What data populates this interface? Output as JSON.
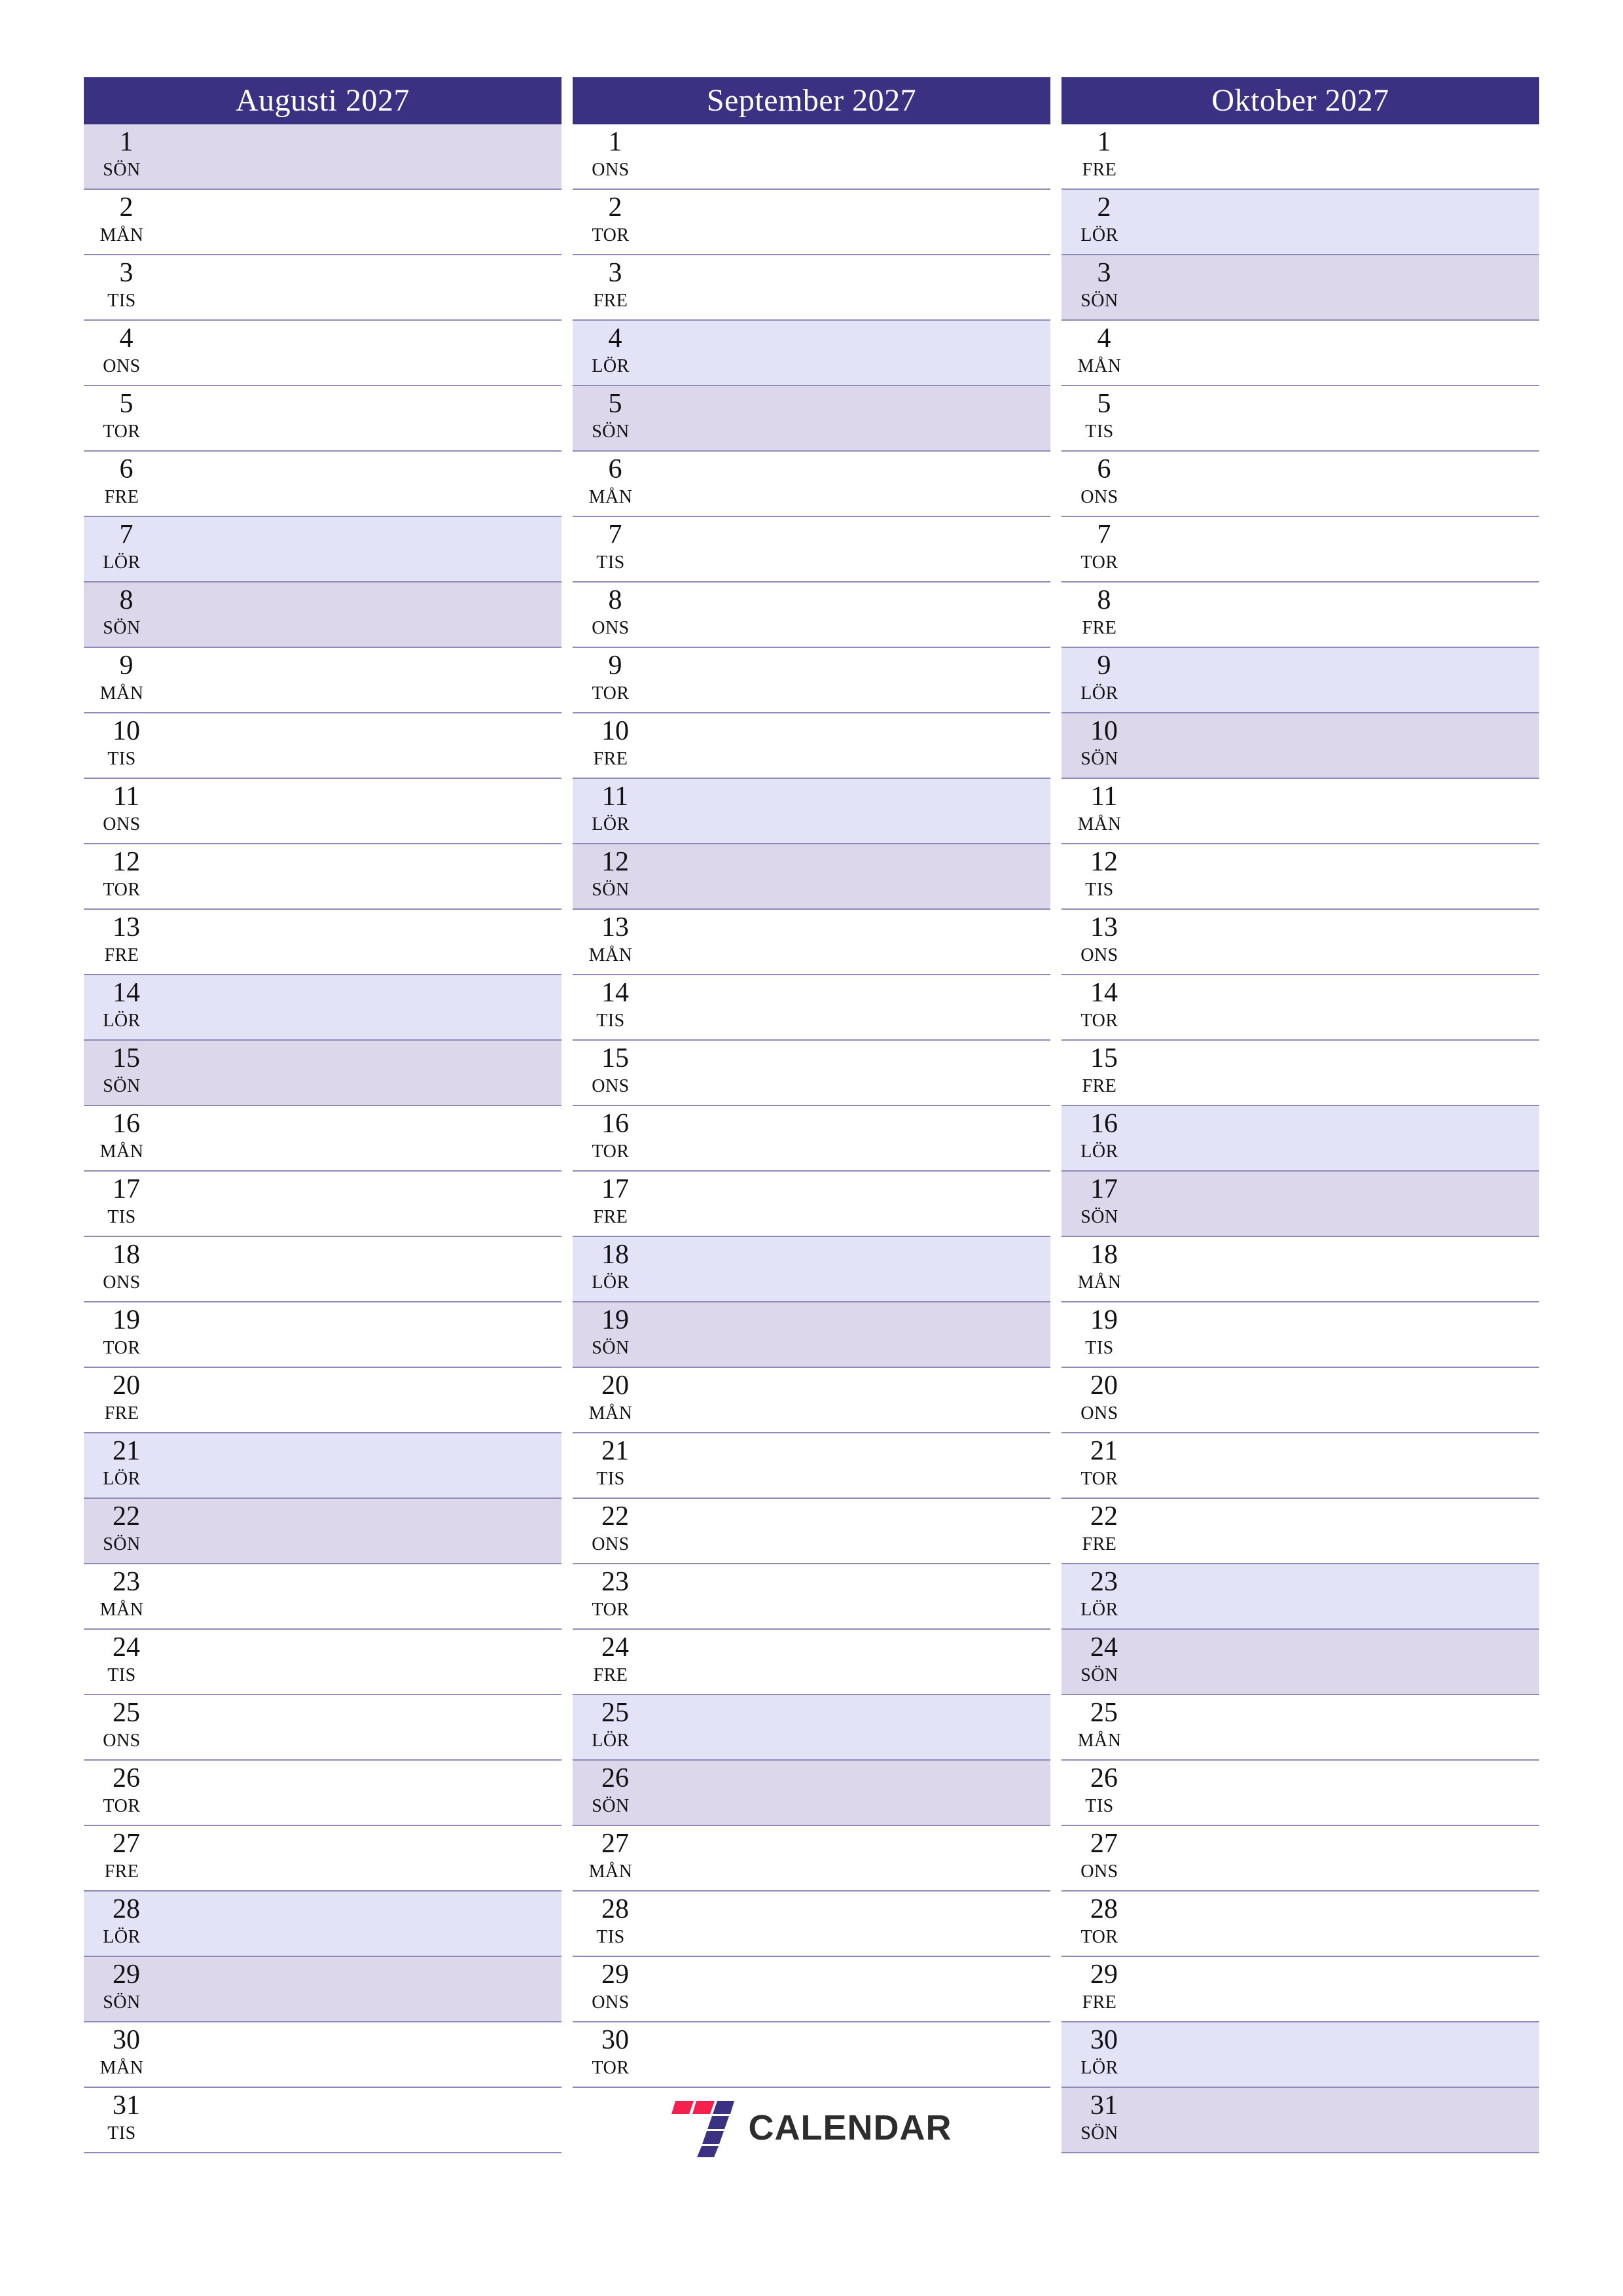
{
  "document": {
    "type": "printable-monthly-planner",
    "language": "sv",
    "year": "2027"
  },
  "colors": {
    "header_bg": "#3b3183",
    "header_text": "#ffffff",
    "saturday_bg": "#e3e3f7",
    "sunday_bg": "#dcd7ea",
    "weekday_bg": "#ffffff",
    "gridline": "#8f8ab9",
    "text": "#111111",
    "logo_red": "#f4204e",
    "logo_blue": "#3b3183",
    "logo_wordmark": "#2d2d2d"
  },
  "brand": {
    "name": "CALENDAR",
    "mark_name": "seven-mark"
  },
  "months": [
    {
      "title": "Augusti 2027",
      "days": [
        {
          "num": "1",
          "wd": "SÖN"
        },
        {
          "num": "2",
          "wd": "MÅN"
        },
        {
          "num": "3",
          "wd": "TIS"
        },
        {
          "num": "4",
          "wd": "ONS"
        },
        {
          "num": "5",
          "wd": "TOR"
        },
        {
          "num": "6",
          "wd": "FRE"
        },
        {
          "num": "7",
          "wd": "LÖR"
        },
        {
          "num": "8",
          "wd": "SÖN"
        },
        {
          "num": "9",
          "wd": "MÅN"
        },
        {
          "num": "10",
          "wd": "TIS"
        },
        {
          "num": "11",
          "wd": "ONS"
        },
        {
          "num": "12",
          "wd": "TOR"
        },
        {
          "num": "13",
          "wd": "FRE"
        },
        {
          "num": "14",
          "wd": "LÖR"
        },
        {
          "num": "15",
          "wd": "SÖN"
        },
        {
          "num": "16",
          "wd": "MÅN"
        },
        {
          "num": "17",
          "wd": "TIS"
        },
        {
          "num": "18",
          "wd": "ONS"
        },
        {
          "num": "19",
          "wd": "TOR"
        },
        {
          "num": "20",
          "wd": "FRE"
        },
        {
          "num": "21",
          "wd": "LÖR"
        },
        {
          "num": "22",
          "wd": "SÖN"
        },
        {
          "num": "23",
          "wd": "MÅN"
        },
        {
          "num": "24",
          "wd": "TIS"
        },
        {
          "num": "25",
          "wd": "ONS"
        },
        {
          "num": "26",
          "wd": "TOR"
        },
        {
          "num": "27",
          "wd": "FRE"
        },
        {
          "num": "28",
          "wd": "LÖR"
        },
        {
          "num": "29",
          "wd": "SÖN"
        },
        {
          "num": "30",
          "wd": "MÅN"
        },
        {
          "num": "31",
          "wd": "TIS"
        }
      ]
    },
    {
      "title": "September 2027",
      "days": [
        {
          "num": "1",
          "wd": "ONS"
        },
        {
          "num": "2",
          "wd": "TOR"
        },
        {
          "num": "3",
          "wd": "FRE"
        },
        {
          "num": "4",
          "wd": "LÖR"
        },
        {
          "num": "5",
          "wd": "SÖN"
        },
        {
          "num": "6",
          "wd": "MÅN"
        },
        {
          "num": "7",
          "wd": "TIS"
        },
        {
          "num": "8",
          "wd": "ONS"
        },
        {
          "num": "9",
          "wd": "TOR"
        },
        {
          "num": "10",
          "wd": "FRE"
        },
        {
          "num": "11",
          "wd": "LÖR"
        },
        {
          "num": "12",
          "wd": "SÖN"
        },
        {
          "num": "13",
          "wd": "MÅN"
        },
        {
          "num": "14",
          "wd": "TIS"
        },
        {
          "num": "15",
          "wd": "ONS"
        },
        {
          "num": "16",
          "wd": "TOR"
        },
        {
          "num": "17",
          "wd": "FRE"
        },
        {
          "num": "18",
          "wd": "LÖR"
        },
        {
          "num": "19",
          "wd": "SÖN"
        },
        {
          "num": "20",
          "wd": "MÅN"
        },
        {
          "num": "21",
          "wd": "TIS"
        },
        {
          "num": "22",
          "wd": "ONS"
        },
        {
          "num": "23",
          "wd": "TOR"
        },
        {
          "num": "24",
          "wd": "FRE"
        },
        {
          "num": "25",
          "wd": "LÖR"
        },
        {
          "num": "26",
          "wd": "SÖN"
        },
        {
          "num": "27",
          "wd": "MÅN"
        },
        {
          "num": "28",
          "wd": "TIS"
        },
        {
          "num": "29",
          "wd": "ONS"
        },
        {
          "num": "30",
          "wd": "TOR"
        }
      ]
    },
    {
      "title": "Oktober 2027",
      "days": [
        {
          "num": "1",
          "wd": "FRE"
        },
        {
          "num": "2",
          "wd": "LÖR"
        },
        {
          "num": "3",
          "wd": "SÖN"
        },
        {
          "num": "4",
          "wd": "MÅN"
        },
        {
          "num": "5",
          "wd": "TIS"
        },
        {
          "num": "6",
          "wd": "ONS"
        },
        {
          "num": "7",
          "wd": "TOR"
        },
        {
          "num": "8",
          "wd": "FRE"
        },
        {
          "num": "9",
          "wd": "LÖR"
        },
        {
          "num": "10",
          "wd": "SÖN"
        },
        {
          "num": "11",
          "wd": "MÅN"
        },
        {
          "num": "12",
          "wd": "TIS"
        },
        {
          "num": "13",
          "wd": "ONS"
        },
        {
          "num": "14",
          "wd": "TOR"
        },
        {
          "num": "15",
          "wd": "FRE"
        },
        {
          "num": "16",
          "wd": "LÖR"
        },
        {
          "num": "17",
          "wd": "SÖN"
        },
        {
          "num": "18",
          "wd": "MÅN"
        },
        {
          "num": "19",
          "wd": "TIS"
        },
        {
          "num": "20",
          "wd": "ONS"
        },
        {
          "num": "21",
          "wd": "TOR"
        },
        {
          "num": "22",
          "wd": "FRE"
        },
        {
          "num": "23",
          "wd": "LÖR"
        },
        {
          "num": "24",
          "wd": "SÖN"
        },
        {
          "num": "25",
          "wd": "MÅN"
        },
        {
          "num": "26",
          "wd": "TIS"
        },
        {
          "num": "27",
          "wd": "ONS"
        },
        {
          "num": "28",
          "wd": "TOR"
        },
        {
          "num": "29",
          "wd": "FRE"
        },
        {
          "num": "30",
          "wd": "LÖR"
        },
        {
          "num": "31",
          "wd": "SÖN"
        }
      ]
    }
  ]
}
